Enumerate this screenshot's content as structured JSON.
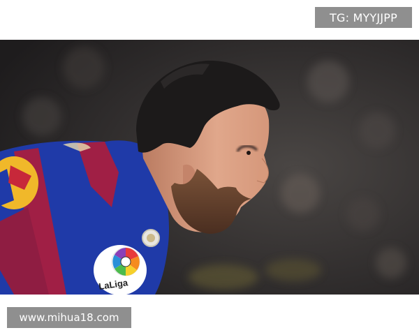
{
  "watermarks": {
    "top_right": "TG: MYYJJPP",
    "bottom_left": "www.mihua18.com"
  },
  "photo": {
    "subject": "footballer-profile",
    "jersey_patch_text": "LaLiga",
    "colors": {
      "background_dark": "#2c2a2b",
      "jersey_blue": "#1f3aa8",
      "jersey_red": "#a01f45",
      "skin": "#d99a7e",
      "hair": "#1c1a1a",
      "beard": "#6b4630",
      "watermark_gray": "#8f8f8f"
    }
  }
}
